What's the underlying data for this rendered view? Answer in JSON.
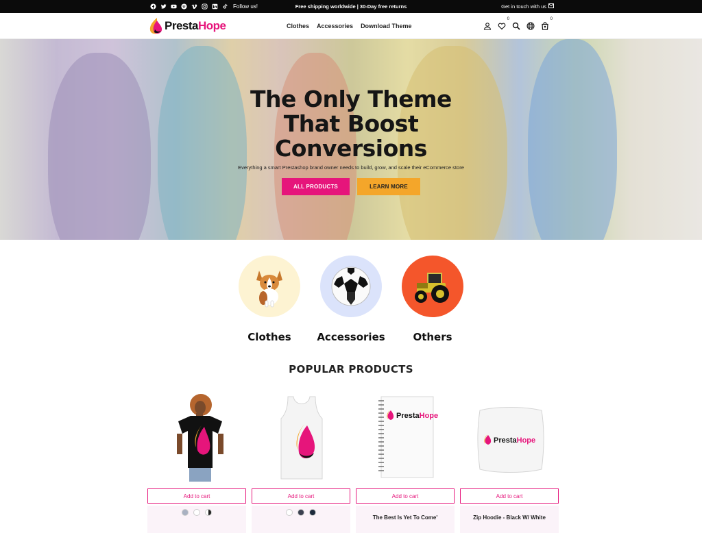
{
  "topbar": {
    "social_icons": [
      "facebook-icon",
      "twitter-icon",
      "youtube-icon",
      "pinterest-icon",
      "vimeo-icon",
      "instagram-icon",
      "linkedin-icon",
      "tiktok-icon"
    ],
    "follow_label": "Follow us!",
    "shipping_text": "Free shipping worldwide | 30-Day free returns",
    "contact_label": "Get in touch with us"
  },
  "header": {
    "logo_part1": "Presta",
    "logo_part2": "Hope",
    "nav": [
      "Clothes",
      "Accessories",
      "Download Theme"
    ],
    "wishlist_count": "0",
    "cart_count": "0"
  },
  "hero": {
    "title_line1": "The Only Theme",
    "title_line2": "That Boost",
    "title_line3": "Conversions",
    "subtitle": "Everything a smart Prestashop brand owner needs to build, grow, and scale their eCommerce store",
    "primary_button": "ALL PRODUCTS",
    "secondary_button": "LEARN MORE"
  },
  "categories": [
    {
      "label": "Clothes",
      "icon": "corgi-dog-icon",
      "bg": "#fdf3d2"
    },
    {
      "label": "Accessories",
      "icon": "soccer-ball-icon",
      "bg": "#dbe3fb"
    },
    {
      "label": "Others",
      "icon": "tractor-icon",
      "bg": "#f4562b"
    }
  ],
  "popular": {
    "title": "POPULAR PRODUCTS",
    "add_to_cart": "Add to cart",
    "products": [
      {
        "name": "",
        "image": "black-tshirt-model-image",
        "swatches": [
          "#a9b1c2",
          "#ffffff",
          "#222222"
        ]
      },
      {
        "name": "",
        "image": "white-tank-top-image",
        "swatches": [
          "#ffffff",
          "#3b4150",
          "#1d2a3c"
        ]
      },
      {
        "name": "The Best Is Yet To Come'",
        "image": "spiral-notebook-image",
        "swatches": []
      },
      {
        "name": "Zip Hoodie - Black W/ White",
        "image": "white-pillow-image",
        "swatches": []
      }
    ]
  },
  "colors": {
    "brand_pink": "#e6157b",
    "brand_yellow": "#f4a62a",
    "topbar": "#0b0b0b"
  }
}
